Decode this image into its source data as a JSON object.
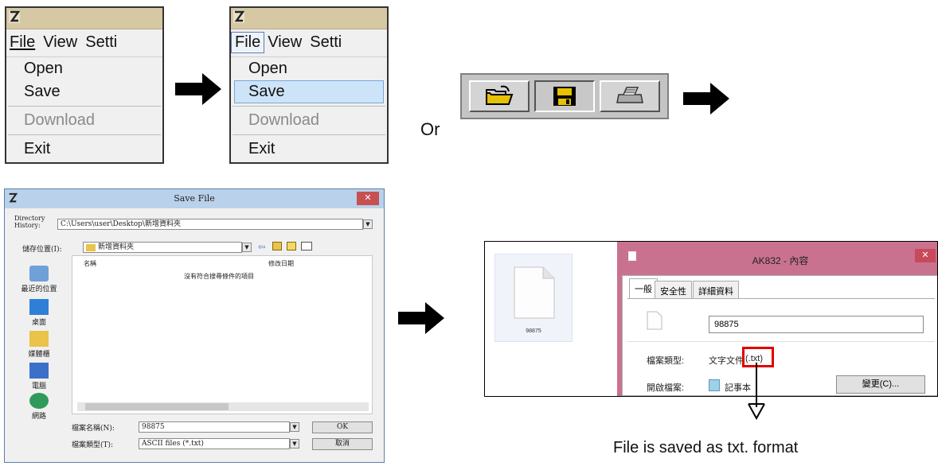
{
  "menu_before": {
    "menubar": [
      "File",
      "View",
      "Setti"
    ],
    "items": [
      "Open",
      "Save",
      "Download",
      "Exit"
    ]
  },
  "menu_after": {
    "menubar": [
      "File",
      "View",
      "Setti"
    ],
    "items": [
      "Open",
      "Save",
      "Download",
      "Exit"
    ],
    "selected": "Save"
  },
  "or_label": "Or",
  "toolbar": {
    "buttons": [
      "open-folder-icon",
      "save-disk-icon",
      "print-icon"
    ]
  },
  "save_dialog": {
    "title": "Save File",
    "directory_history_label": "Directory History:",
    "directory_history_value": "C:\\Users\\user\\Desktop\\新增資料夾",
    "save_in_label": "儲存位置(I):",
    "save_in_value": "新增資料夾",
    "col_name": "名稱",
    "col_modified": "修改日期",
    "empty_message": "沒有符合搜尋條件的項目",
    "places": [
      "最近的位置",
      "桌面",
      "媒體櫃",
      "電腦",
      "網路"
    ],
    "filename_label": "檔案名稱(N):",
    "filename_value": "98875",
    "filetype_label": "檔案類型(T):",
    "filetype_value": "ASCII files (*.txt)",
    "ok_label": "OK",
    "cancel_label": "取消"
  },
  "properties": {
    "file_tile_name": "98875",
    "window_title": "AK832 - 內容",
    "tabs": [
      "一般",
      "安全性",
      "詳細資料"
    ],
    "name_value": "98875",
    "filetype_label": "檔案類型:",
    "filetype_value": "文字文件",
    "filetype_ext": "(.txt)",
    "openwith_label": "開啟檔案:",
    "openwith_value": "記事本",
    "change_button": "變更(C)..."
  },
  "caption": "File is saved as txt. format",
  "colors": {
    "highlight_box": "#e00000",
    "props_titlebar": "#c9728f",
    "menu_selection": "#cde4f8"
  }
}
